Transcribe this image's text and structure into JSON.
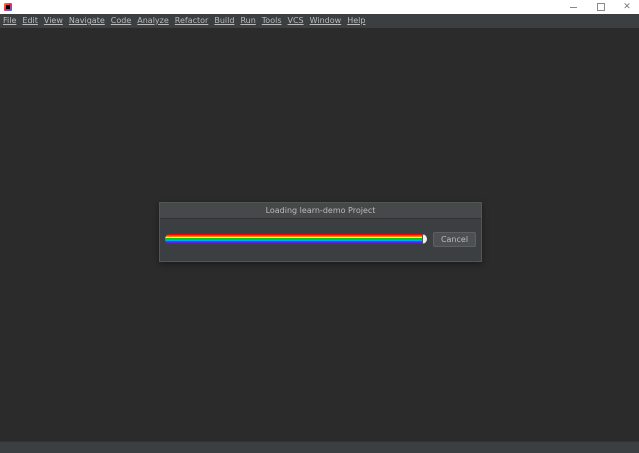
{
  "menubar": {
    "items": [
      {
        "label": "File"
      },
      {
        "label": "Edit"
      },
      {
        "label": "View"
      },
      {
        "label": "Navigate"
      },
      {
        "label": "Code"
      },
      {
        "label": "Analyze"
      },
      {
        "label": "Refactor"
      },
      {
        "label": "Build"
      },
      {
        "label": "Run"
      },
      {
        "label": "Tools"
      },
      {
        "label": "VCS"
      },
      {
        "label": "Window"
      },
      {
        "label": "Help"
      }
    ]
  },
  "titlebar": {
    "app_icon": "intellij-idea-icon",
    "minimize_icon": "minimize-icon",
    "maximize_icon": "maximize-icon",
    "close_icon": "close-icon",
    "close_glyph": "✕"
  },
  "dialog": {
    "title": "Loading learn-demo Project",
    "progress_fraction": 0.98,
    "progress_style": "rainbow",
    "cancel_label": "Cancel"
  },
  "colors": {
    "background": "#2b2b2b",
    "panel": "#3c3f41",
    "text": "#bbbbbb"
  }
}
